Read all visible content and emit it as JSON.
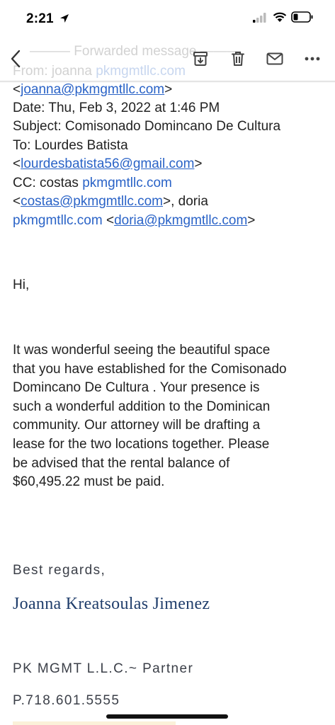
{
  "status_bar": {
    "time": "2:21"
  },
  "ghost": {
    "line1": "——— Forwarded message ———",
    "from_prefix": "From: joanna ",
    "from_link": "pkmgmtllc.com"
  },
  "header": {
    "from_email": "joanna@pkmgmtllc.com",
    "date_line": "Date: Thu, Feb 3, 2022 at 1:46 PM",
    "subject_line": "Subject: Comisonado Domincano De Cultura",
    "to_line": "To: Lourdes Batista",
    "to_email": "lourdesbatista56@gmail.com",
    "cc_prefix": "CC: costas ",
    "cc_domain1": "pkmgmtllc.com",
    "cc_email1": "costas@pkmgmtllc.com",
    "cc_mid": ", doria",
    "cc_domain2": "pkmgmtllc.com",
    "cc_email2": "doria@pkmgmtllc.com",
    "lt": "<",
    "gt": ">"
  },
  "body": {
    "greeting": "Hi,",
    "paragraph_lines": [
      "It was wonderful seeing the beautiful space",
      "that you have established for the Comisonado",
      "Domincano De Cultura .  Your presence is",
      "such a wonderful addition to the Dominican",
      "community.  Our attorney will be drafting a",
      "lease for the two locations together.  Please",
      "be advised that the rental balance of",
      "$60,495.22 must be paid."
    ]
  },
  "signature": {
    "closing": "Best regards,",
    "name": "Joanna Kreatsoulas Jimenez",
    "company": "PK MGMT L.L.C.~ Partner",
    "phone": "P.718.601.5555"
  }
}
